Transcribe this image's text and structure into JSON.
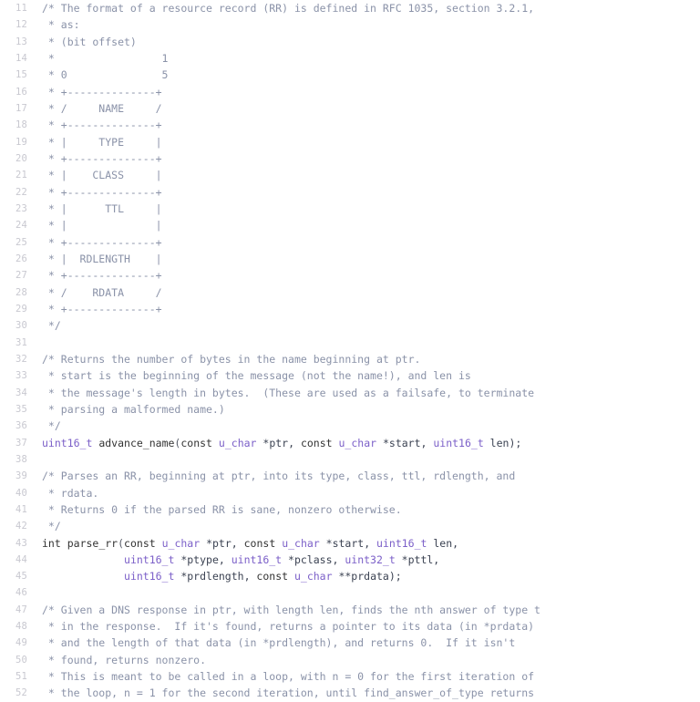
{
  "editor": {
    "language": "C",
    "first_line_number": 11,
    "last_line_number": 52,
    "background_color": "#ffffff",
    "gutter_color": "#c8c8d0",
    "colors": {
      "comment": "#8a92a8",
      "type": "#7b5fc8",
      "function": "#4477cc",
      "keyword": "#e0537a",
      "plain": "#3b4252"
    }
  },
  "lines": [
    {
      "n": "11",
      "tokens": [
        {
          "t": "/* The format of a resource record (RR) is defined in RFC 1035, section 3.2.1,",
          "c": "comment"
        }
      ]
    },
    {
      "n": "12",
      "tokens": [
        {
          "t": " * as:",
          "c": "comment"
        }
      ]
    },
    {
      "n": "13",
      "tokens": [
        {
          "t": " * (bit offset)",
          "c": "comment"
        }
      ]
    },
    {
      "n": "14",
      "tokens": [
        {
          "t": " *                 1",
          "c": "comment"
        }
      ]
    },
    {
      "n": "15",
      "tokens": [
        {
          "t": " * 0               5",
          "c": "comment"
        }
      ]
    },
    {
      "n": "16",
      "tokens": [
        {
          "t": " * +--------------+",
          "c": "comment"
        }
      ]
    },
    {
      "n": "17",
      "tokens": [
        {
          "t": " * /     NAME     /",
          "c": "comment"
        }
      ]
    },
    {
      "n": "18",
      "tokens": [
        {
          "t": " * +--------------+",
          "c": "comment"
        }
      ]
    },
    {
      "n": "19",
      "tokens": [
        {
          "t": " * |     TYPE     |",
          "c": "comment"
        }
      ]
    },
    {
      "n": "20",
      "tokens": [
        {
          "t": " * +--------------+",
          "c": "comment"
        }
      ]
    },
    {
      "n": "21",
      "tokens": [
        {
          "t": " * |    CLASS     |",
          "c": "comment"
        }
      ]
    },
    {
      "n": "22",
      "tokens": [
        {
          "t": " * +--------------+",
          "c": "comment"
        }
      ]
    },
    {
      "n": "23",
      "tokens": [
        {
          "t": " * |      TTL     |",
          "c": "comment"
        }
      ]
    },
    {
      "n": "24",
      "tokens": [
        {
          "t": " * |              |",
          "c": "comment"
        }
      ]
    },
    {
      "n": "25",
      "tokens": [
        {
          "t": " * +--------------+",
          "c": "comment"
        }
      ]
    },
    {
      "n": "26",
      "tokens": [
        {
          "t": " * |  RDLENGTH    |",
          "c": "comment"
        }
      ]
    },
    {
      "n": "27",
      "tokens": [
        {
          "t": " * +--------------+",
          "c": "comment"
        }
      ]
    },
    {
      "n": "28",
      "tokens": [
        {
          "t": " * /    RDATA     /",
          "c": "comment"
        }
      ]
    },
    {
      "n": "29",
      "tokens": [
        {
          "t": " * +--------------+",
          "c": "comment"
        }
      ]
    },
    {
      "n": "30",
      "tokens": [
        {
          "t": " */",
          "c": "comment"
        }
      ]
    },
    {
      "n": "31",
      "tokens": []
    },
    {
      "n": "32",
      "tokens": [
        {
          "t": "/* Returns the number of bytes in the name beginning at ptr.",
          "c": "comment"
        }
      ]
    },
    {
      "n": "33",
      "tokens": [
        {
          "t": " * start is the beginning of the message (not the name!), and len is",
          "c": "comment"
        }
      ]
    },
    {
      "n": "34",
      "tokens": [
        {
          "t": " * the message's length in bytes.  (These are used as a failsafe, to terminate",
          "c": "comment"
        }
      ]
    },
    {
      "n": "35",
      "tokens": [
        {
          "t": " * parsing a malformed name.)",
          "c": "comment"
        }
      ]
    },
    {
      "n": "36",
      "tokens": [
        {
          "t": " */",
          "c": "comment"
        }
      ]
    },
    {
      "n": "37",
      "tokens": [
        {
          "t": "uint16_t",
          "c": "type"
        },
        {
          "t": " ",
          "c": "plain"
        },
        {
          "t": "advance_name",
          "c": "function"
        },
        {
          "t": "(",
          "c": "punct"
        },
        {
          "t": "const",
          "c": "keyword"
        },
        {
          "t": " ",
          "c": "plain"
        },
        {
          "t": "u_char",
          "c": "type"
        },
        {
          "t": " *ptr, ",
          "c": "plain"
        },
        {
          "t": "const",
          "c": "keyword"
        },
        {
          "t": " ",
          "c": "plain"
        },
        {
          "t": "u_char",
          "c": "type"
        },
        {
          "t": " *start, ",
          "c": "plain"
        },
        {
          "t": "uint16_t",
          "c": "type"
        },
        {
          "t": " len);",
          "c": "plain"
        }
      ]
    },
    {
      "n": "38",
      "tokens": []
    },
    {
      "n": "39",
      "tokens": [
        {
          "t": "/* Parses an RR, beginning at ptr, into its type, class, ttl, rdlength, and",
          "c": "comment"
        }
      ]
    },
    {
      "n": "40",
      "tokens": [
        {
          "t": " * rdata.",
          "c": "comment"
        }
      ]
    },
    {
      "n": "41",
      "tokens": [
        {
          "t": " * Returns 0 if the parsed RR is sane, nonzero otherwise.",
          "c": "comment"
        }
      ]
    },
    {
      "n": "42",
      "tokens": [
        {
          "t": " */",
          "c": "comment"
        }
      ]
    },
    {
      "n": "43",
      "tokens": [
        {
          "t": "int",
          "c": "keyword"
        },
        {
          "t": " ",
          "c": "plain"
        },
        {
          "t": "parse_rr",
          "c": "function"
        },
        {
          "t": "(",
          "c": "punct"
        },
        {
          "t": "const",
          "c": "keyword"
        },
        {
          "t": " ",
          "c": "plain"
        },
        {
          "t": "u_char",
          "c": "type"
        },
        {
          "t": " *ptr, ",
          "c": "plain"
        },
        {
          "t": "const",
          "c": "keyword"
        },
        {
          "t": " ",
          "c": "plain"
        },
        {
          "t": "u_char",
          "c": "type"
        },
        {
          "t": " *start, ",
          "c": "plain"
        },
        {
          "t": "uint16_t",
          "c": "type"
        },
        {
          "t": " len,",
          "c": "plain"
        }
      ]
    },
    {
      "n": "44",
      "tokens": [
        {
          "t": "             ",
          "c": "plain"
        },
        {
          "t": "uint16_t",
          "c": "type"
        },
        {
          "t": " *ptype, ",
          "c": "plain"
        },
        {
          "t": "uint16_t",
          "c": "type"
        },
        {
          "t": " *pclass, ",
          "c": "plain"
        },
        {
          "t": "uint32_t",
          "c": "type"
        },
        {
          "t": " *pttl,",
          "c": "plain"
        }
      ]
    },
    {
      "n": "45",
      "tokens": [
        {
          "t": "             ",
          "c": "plain"
        },
        {
          "t": "uint16_t",
          "c": "type"
        },
        {
          "t": " *prdlength, ",
          "c": "plain"
        },
        {
          "t": "const",
          "c": "keyword"
        },
        {
          "t": " ",
          "c": "plain"
        },
        {
          "t": "u_char",
          "c": "type"
        },
        {
          "t": " **prdata);",
          "c": "plain"
        }
      ]
    },
    {
      "n": "46",
      "tokens": []
    },
    {
      "n": "47",
      "tokens": [
        {
          "t": "/* Given a DNS response in ptr, with length len, finds the nth answer of type t",
          "c": "comment"
        }
      ]
    },
    {
      "n": "48",
      "tokens": [
        {
          "t": " * in the response.  If it's found, returns a pointer to its data (in *prdata)",
          "c": "comment"
        }
      ]
    },
    {
      "n": "49",
      "tokens": [
        {
          "t": " * and the length of that data (in *prdlength), and returns 0.  If it isn't",
          "c": "comment"
        }
      ]
    },
    {
      "n": "50",
      "tokens": [
        {
          "t": " * found, returns nonzero.",
          "c": "comment"
        }
      ]
    },
    {
      "n": "51",
      "tokens": [
        {
          "t": " * This is meant to be called in a loop, with n = 0 for the first iteration of",
          "c": "comment"
        }
      ]
    },
    {
      "n": "52",
      "tokens": [
        {
          "t": " * the loop, n = 1 for the second iteration, until find_answer_of_type returns",
          "c": "comment"
        }
      ]
    }
  ]
}
